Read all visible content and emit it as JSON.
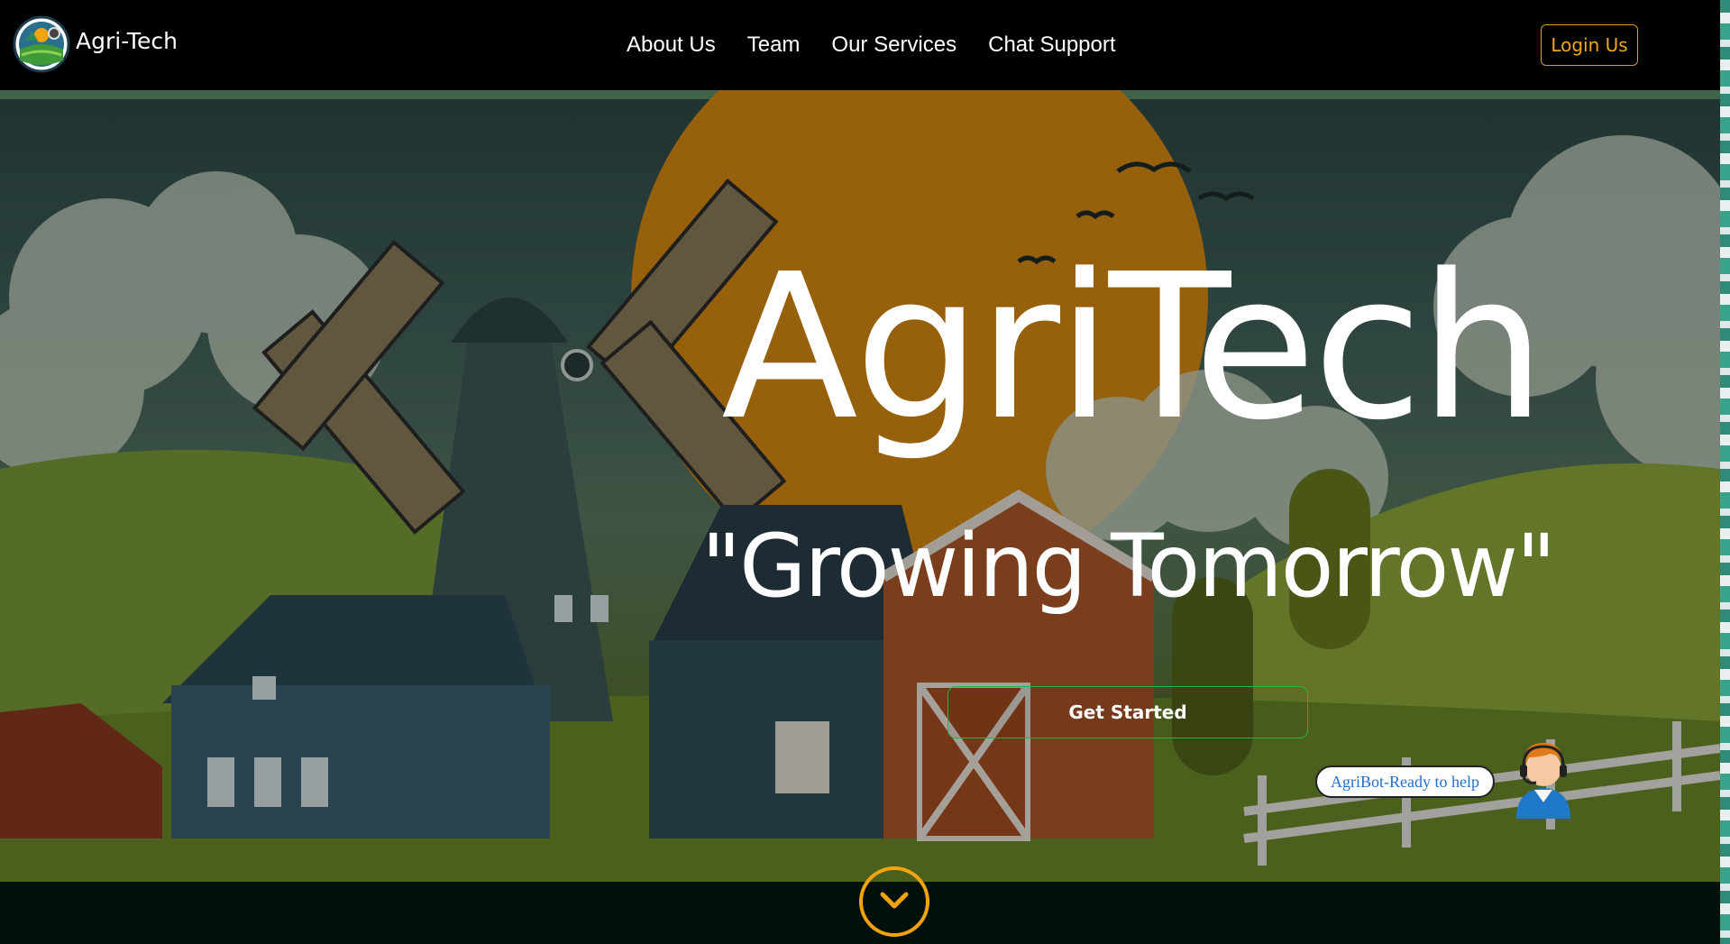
{
  "navbar": {
    "brand": "Agri-Tech",
    "links": [
      {
        "label": "About Us"
      },
      {
        "label": "Team"
      },
      {
        "label": "Our Services"
      },
      {
        "label": "Chat Support"
      }
    ],
    "login_label": "Login Us"
  },
  "hero": {
    "title": "AgriTech",
    "tagline": "\"Growing Tomorrow\"",
    "cta_label": "Get Started"
  },
  "chatbot": {
    "bubble_text": "AgriBot-Ready to help",
    "avatar_icon": "support-agent-icon"
  },
  "scroll": {
    "icon": "chevron-down-icon"
  },
  "colors": {
    "accent_orange": "#f5a30b",
    "login_border": "#d99c1f",
    "cta_border": "#1fb83a",
    "bot_text": "#1f6fd1"
  }
}
